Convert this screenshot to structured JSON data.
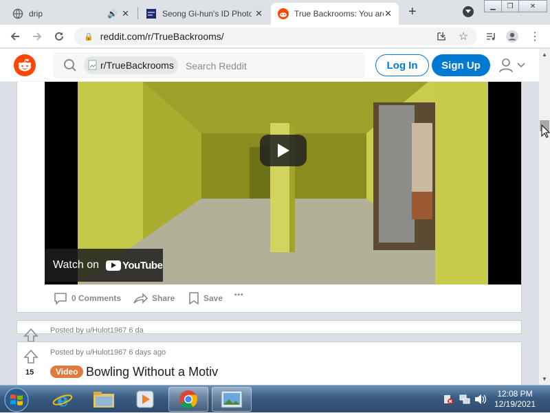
{
  "browser": {
    "tabs": [
      {
        "title": "drip",
        "muted_icon": "speaker-icon",
        "active": false
      },
      {
        "title": "Seong Gi-hun's ID Photo",
        "active": false
      },
      {
        "title": "True Backrooms: You are",
        "active": true
      }
    ],
    "new_tab": "+",
    "url": "reddit.com/r/TrueBackrooms/"
  },
  "reddit": {
    "subreddit_chip": "r/TrueBackrooms",
    "subreddit_icon_alt": "Subreddit Icon",
    "search_placeholder": "Search Reddit",
    "login_label": "Log In",
    "signup_label": "Sign Up"
  },
  "post1": {
    "watch_on": "Watch on",
    "youtube": "YouTube",
    "comments": "0 Comments",
    "share": "Share",
    "save": "Save",
    "more": "•••"
  },
  "post2": {
    "posted_by": "Posted by u/Hulot1967 6 da"
  },
  "post3": {
    "posted_by": "Posted by u/Hulot1967 6 days ago",
    "votes": "15",
    "flair": "Video",
    "title": "Bowling Without a Motiv"
  },
  "taskbar": {
    "time": "12:08 PM",
    "date": "12/19/2021"
  },
  "colors": {
    "reddit_orange": "#ff4500",
    "reddit_blue": "#0079d3",
    "flair_orange": "#e07a3f"
  }
}
